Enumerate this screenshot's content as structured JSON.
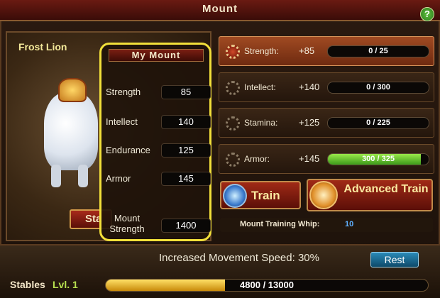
{
  "window": {
    "title": "Mount",
    "help_label": "?"
  },
  "character": {
    "name": "Frost Lion",
    "stable_button_label": "Sta"
  },
  "my_mount": {
    "header": "My Mount",
    "stats": [
      {
        "label": "Strength",
        "value": "85"
      },
      {
        "label": "Intellect",
        "value": "140"
      },
      {
        "label": "Endurance",
        "value": "125"
      },
      {
        "label": "Armor",
        "value": "145"
      }
    ],
    "mount_strength_label": "Mount Strength",
    "mount_strength_value": "1400"
  },
  "training": [
    {
      "name": "Strength:",
      "bonus": "+85",
      "progress_text": "0 / 25",
      "progress": 0.0,
      "selected": true
    },
    {
      "name": "Intellect:",
      "bonus": "+140",
      "progress_text": "0 / 300",
      "progress": 0.0,
      "selected": false
    },
    {
      "name": "Stamina:",
      "bonus": "+125",
      "progress_text": "0 / 225",
      "progress": 0.0,
      "selected": false
    },
    {
      "name": "Armor:",
      "bonus": "+145",
      "progress_text": "300 / 325",
      "progress": 0.923,
      "selected": false
    }
  ],
  "buttons": {
    "train": "Train",
    "advanced_train": "Advanced Train",
    "rest": "Rest"
  },
  "whip": {
    "label": "Mount Training Whip:",
    "value": "10"
  },
  "movement_speed": "Increased Movement Speed: 30%",
  "stables": {
    "label": "Stables",
    "level": "Lvl. 1",
    "xp_text": "4800 / 13000",
    "xp_progress": 0.369
  },
  "colors": {
    "highlight": "#f2e03a",
    "progress_green": "#6cc02a",
    "xp_gold": "#e8b02a"
  }
}
